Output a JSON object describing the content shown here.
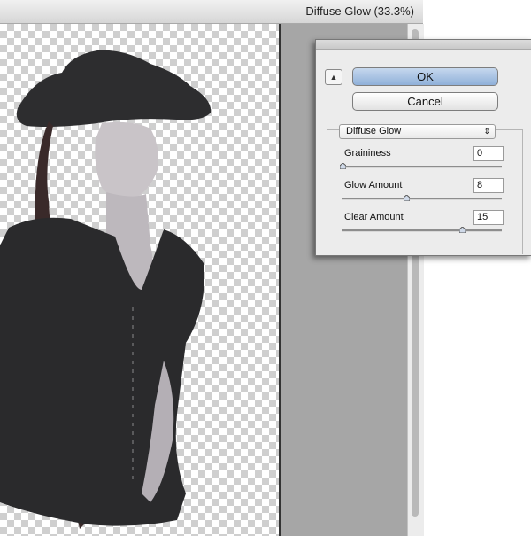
{
  "window": {
    "title": "Diffuse Glow (33.3%)"
  },
  "dialog": {
    "ok_label": "OK",
    "cancel_label": "Cancel",
    "collapse_glyph": "▲",
    "filter_select": {
      "value": "Diffuse Glow",
      "arrow_glyph": "⇕"
    },
    "params": [
      {
        "label": "Graininess",
        "value": "0",
        "slider_fraction": 0.0
      },
      {
        "label": "Glow Amount",
        "value": "8",
        "slider_fraction": 0.4
      },
      {
        "label": "Clear Amount",
        "value": "15",
        "slider_fraction": 0.75
      }
    ]
  },
  "colors": {
    "ok_button": "#9dbde3",
    "canvas_gray": "#a6a6a6",
    "checker": "#cfcfcf"
  }
}
